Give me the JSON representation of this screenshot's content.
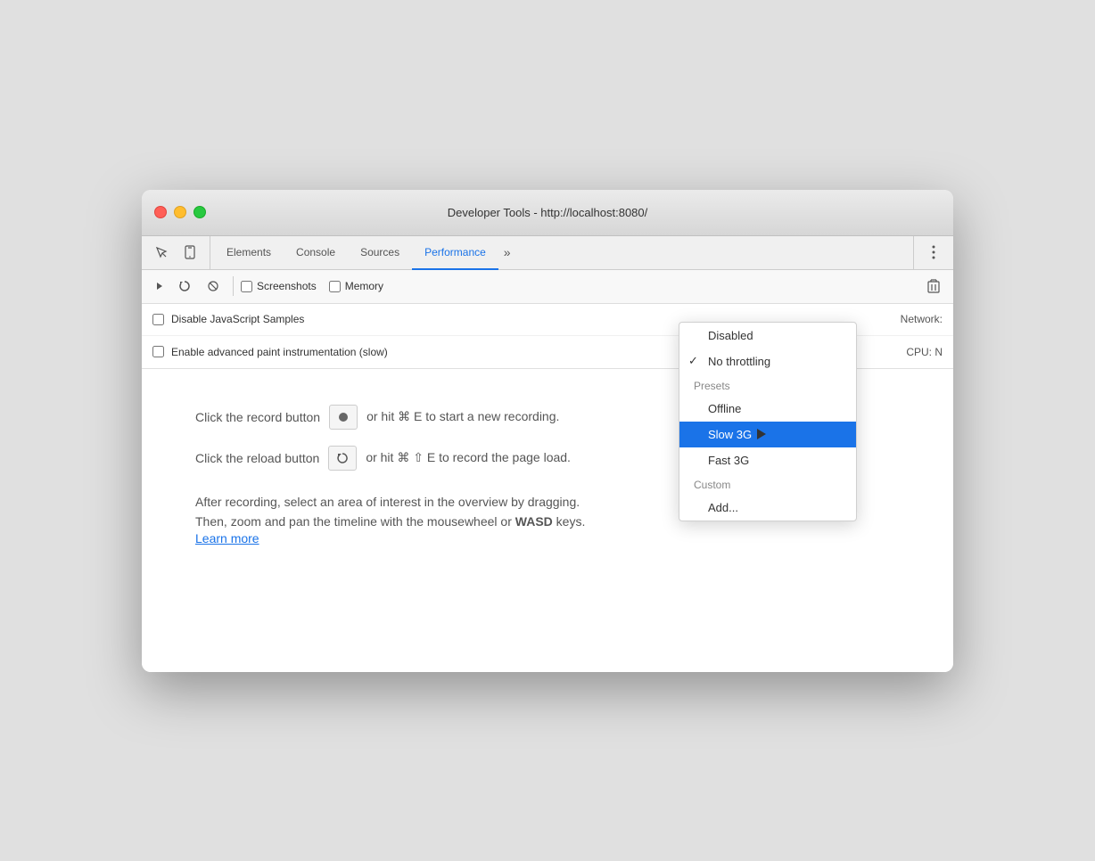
{
  "window": {
    "title": "Developer Tools - http://localhost:8080/"
  },
  "tabs": [
    {
      "id": "elements",
      "label": "Elements",
      "active": false
    },
    {
      "id": "console",
      "label": "Console",
      "active": false
    },
    {
      "id": "sources",
      "label": "Sources",
      "active": false
    },
    {
      "id": "performance",
      "label": "Performance",
      "active": true
    }
  ],
  "tab_more_label": "»",
  "toolbar": {
    "screenshots_label": "Screenshots",
    "memory_label": "Memory",
    "trash_icon": "🗑"
  },
  "settings": {
    "row1": {
      "checkbox_label": "Disable JavaScript Samples",
      "network_label": "Network:"
    },
    "row2": {
      "checkbox_label": "Enable advanced paint instrumentation (slow)",
      "cpu_label": "CPU: N"
    }
  },
  "instructions": {
    "record_text_before": "Click the record button",
    "record_icon": "⏺",
    "record_text_after": "or hit ⌘ E to start a new recording.",
    "reload_text_before": "Click the reload button",
    "reload_icon": "↻",
    "reload_text_after": "or hit ⌘ ⇧ E to record the page load.",
    "info_line1": "After recording, select an area of interest in the overview by dragging.",
    "info_line2": "Then, zoom and pan the timeline with the mousewheel or",
    "info_bold": "WASD",
    "info_line3": " keys.",
    "learn_more": "Learn more"
  },
  "dropdown": {
    "items": [
      {
        "id": "disabled",
        "label": "Disabled",
        "type": "category-item",
        "checked": false
      },
      {
        "id": "no-throttling",
        "label": "No throttling",
        "type": "item",
        "checked": true
      },
      {
        "id": "presets",
        "label": "Presets",
        "type": "category",
        "checked": false
      },
      {
        "id": "offline",
        "label": "Offline",
        "type": "item",
        "checked": false
      },
      {
        "id": "slow-3g",
        "label": "Slow 3G",
        "type": "item",
        "selected": true,
        "checked": false
      },
      {
        "id": "fast-3g",
        "label": "Fast 3G",
        "type": "item",
        "checked": false
      },
      {
        "id": "custom",
        "label": "Custom",
        "type": "category",
        "checked": false
      },
      {
        "id": "add",
        "label": "Add...",
        "type": "item",
        "checked": false
      }
    ]
  }
}
